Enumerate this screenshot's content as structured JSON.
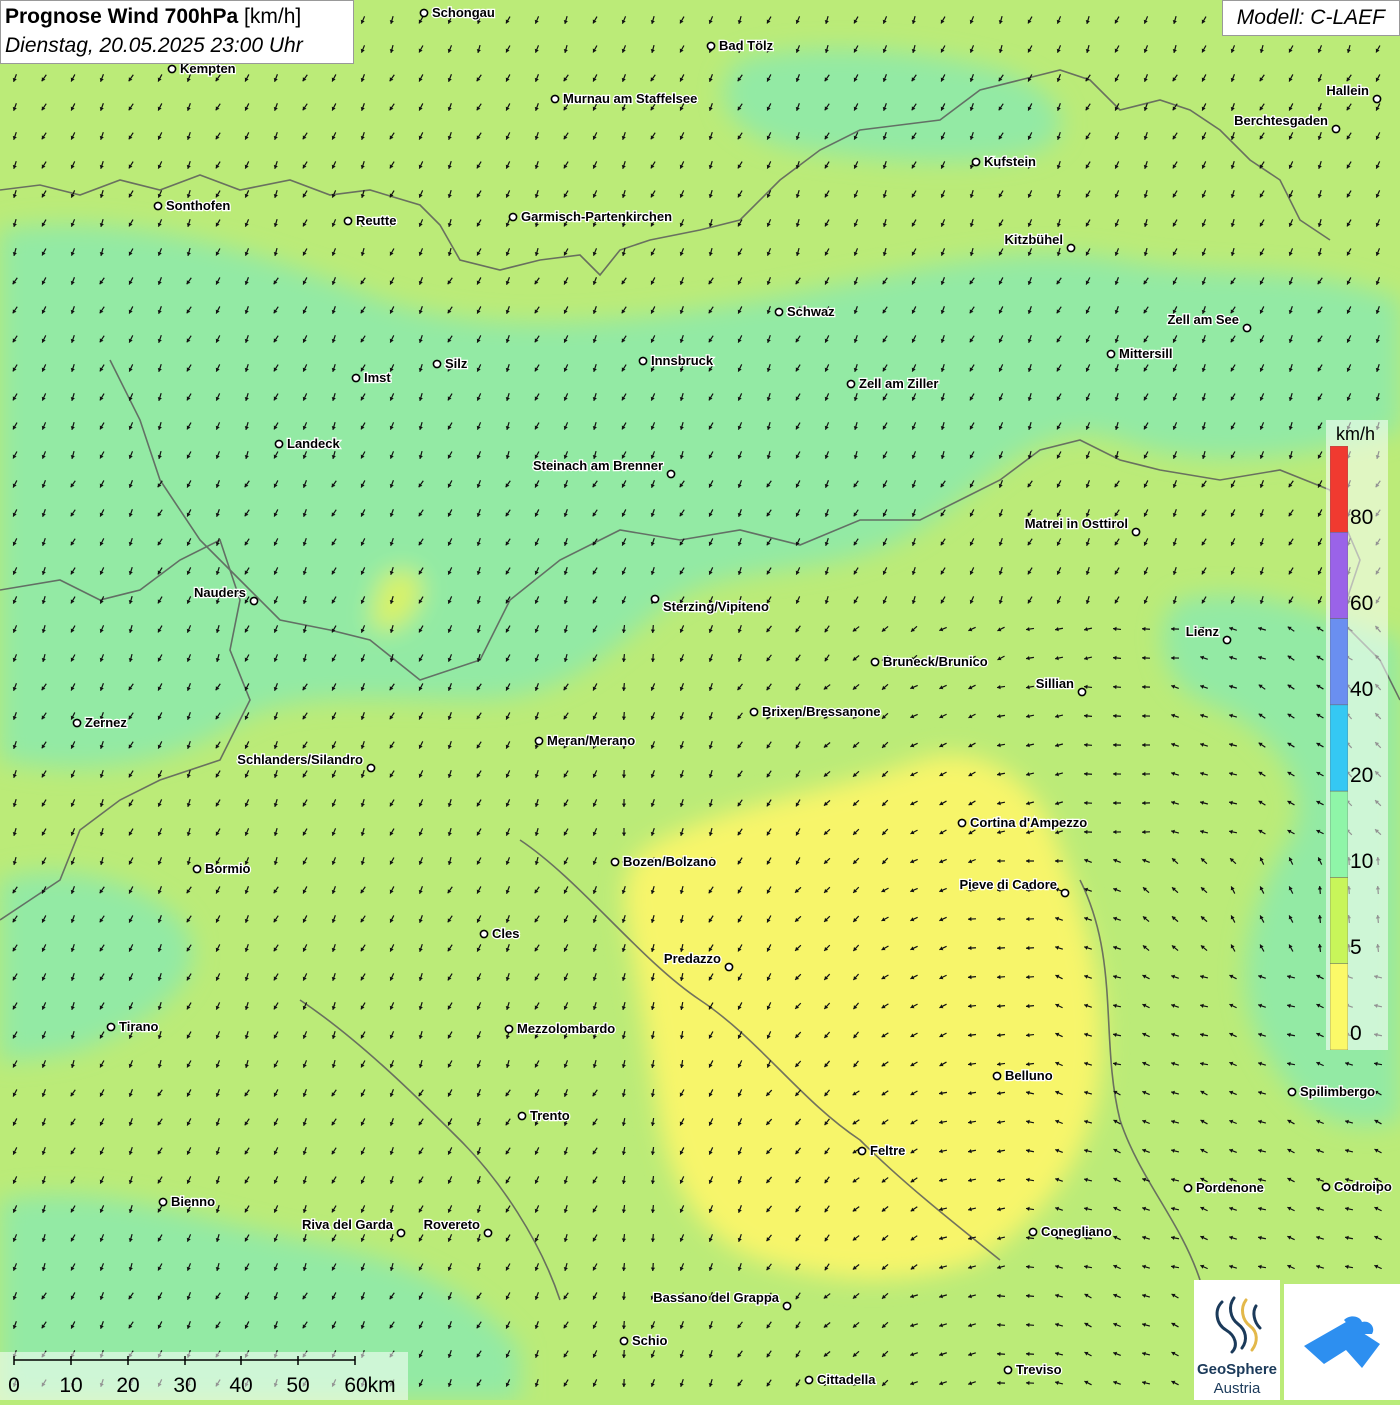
{
  "header": {
    "title_bold": "Prognose Wind 700hPa",
    "title_unit": "[km/h]",
    "datetime": "Dienstag, 20.05.2025 23:00 Uhr"
  },
  "model": {
    "label": "Modell: C-LAEF"
  },
  "legend": {
    "unit": "km/h",
    "labels": [
      "80",
      "60",
      "40",
      "20",
      "10",
      "5",
      "0"
    ],
    "colors": [
      "#f03a30",
      "#9a63e8",
      "#6a8ff0",
      "#35c8f3",
      "#8ff5a8",
      "#c8f55a",
      "#fbf968"
    ]
  },
  "scale": {
    "labels": [
      "0",
      "10",
      "20",
      "30",
      "40",
      "50",
      "60km"
    ]
  },
  "logos": {
    "geosphere_name": "GeoSphere",
    "geosphere_sub": "Austria"
  },
  "cities": [
    {
      "name": "Schongau"
    },
    {
      "name": "Bad Tölz"
    },
    {
      "name": "Kempten"
    },
    {
      "name": "Murnau am Staffelsee"
    },
    {
      "name": "Hallein"
    },
    {
      "name": "Berchtesgaden"
    },
    {
      "name": "Kufstein"
    },
    {
      "name": "Sonthofen"
    },
    {
      "name": "Reutte"
    },
    {
      "name": "Garmisch-Partenkirchen"
    },
    {
      "name": "Kitzbühel"
    },
    {
      "name": "Schwaz"
    },
    {
      "name": "Zell am See"
    },
    {
      "name": "Mittersill"
    },
    {
      "name": "Silz"
    },
    {
      "name": "Innsbruck"
    },
    {
      "name": "Imst"
    },
    {
      "name": "Zell am Ziller"
    },
    {
      "name": "Landeck"
    },
    {
      "name": "Steinach am Brenner"
    },
    {
      "name": "Matrei in Osttirol"
    },
    {
      "name": "Nauders"
    },
    {
      "name": "Sterzing/Vipiteno"
    },
    {
      "name": "Lienz"
    },
    {
      "name": "Bruneck/Brunico"
    },
    {
      "name": "Sillian"
    },
    {
      "name": "Brixen/Bressanone"
    },
    {
      "name": "Zernez"
    },
    {
      "name": "Meran/Merano"
    },
    {
      "name": "Schlanders/Silandro"
    },
    {
      "name": "Cortina d'Ampezzo"
    },
    {
      "name": "Bozen/Bolzano"
    },
    {
      "name": "Bormio"
    },
    {
      "name": "Pieve di Cadore"
    },
    {
      "name": "Cles"
    },
    {
      "name": "Predazzo"
    },
    {
      "name": "Tirano"
    },
    {
      "name": "Mezzolombardo"
    },
    {
      "name": "Belluno"
    },
    {
      "name": "Spilimbergo"
    },
    {
      "name": "Trento"
    },
    {
      "name": "Feltre"
    },
    {
      "name": "Pordenone"
    },
    {
      "name": "Codroipo"
    },
    {
      "name": "Bienno"
    },
    {
      "name": "Riva del Garda"
    },
    {
      "name": "Rovereto"
    },
    {
      "name": "Conegliano"
    },
    {
      "name": "Bassano del Grappa"
    },
    {
      "name": "Schio"
    },
    {
      "name": "Treviso"
    },
    {
      "name": "Cittadella"
    }
  ]
}
